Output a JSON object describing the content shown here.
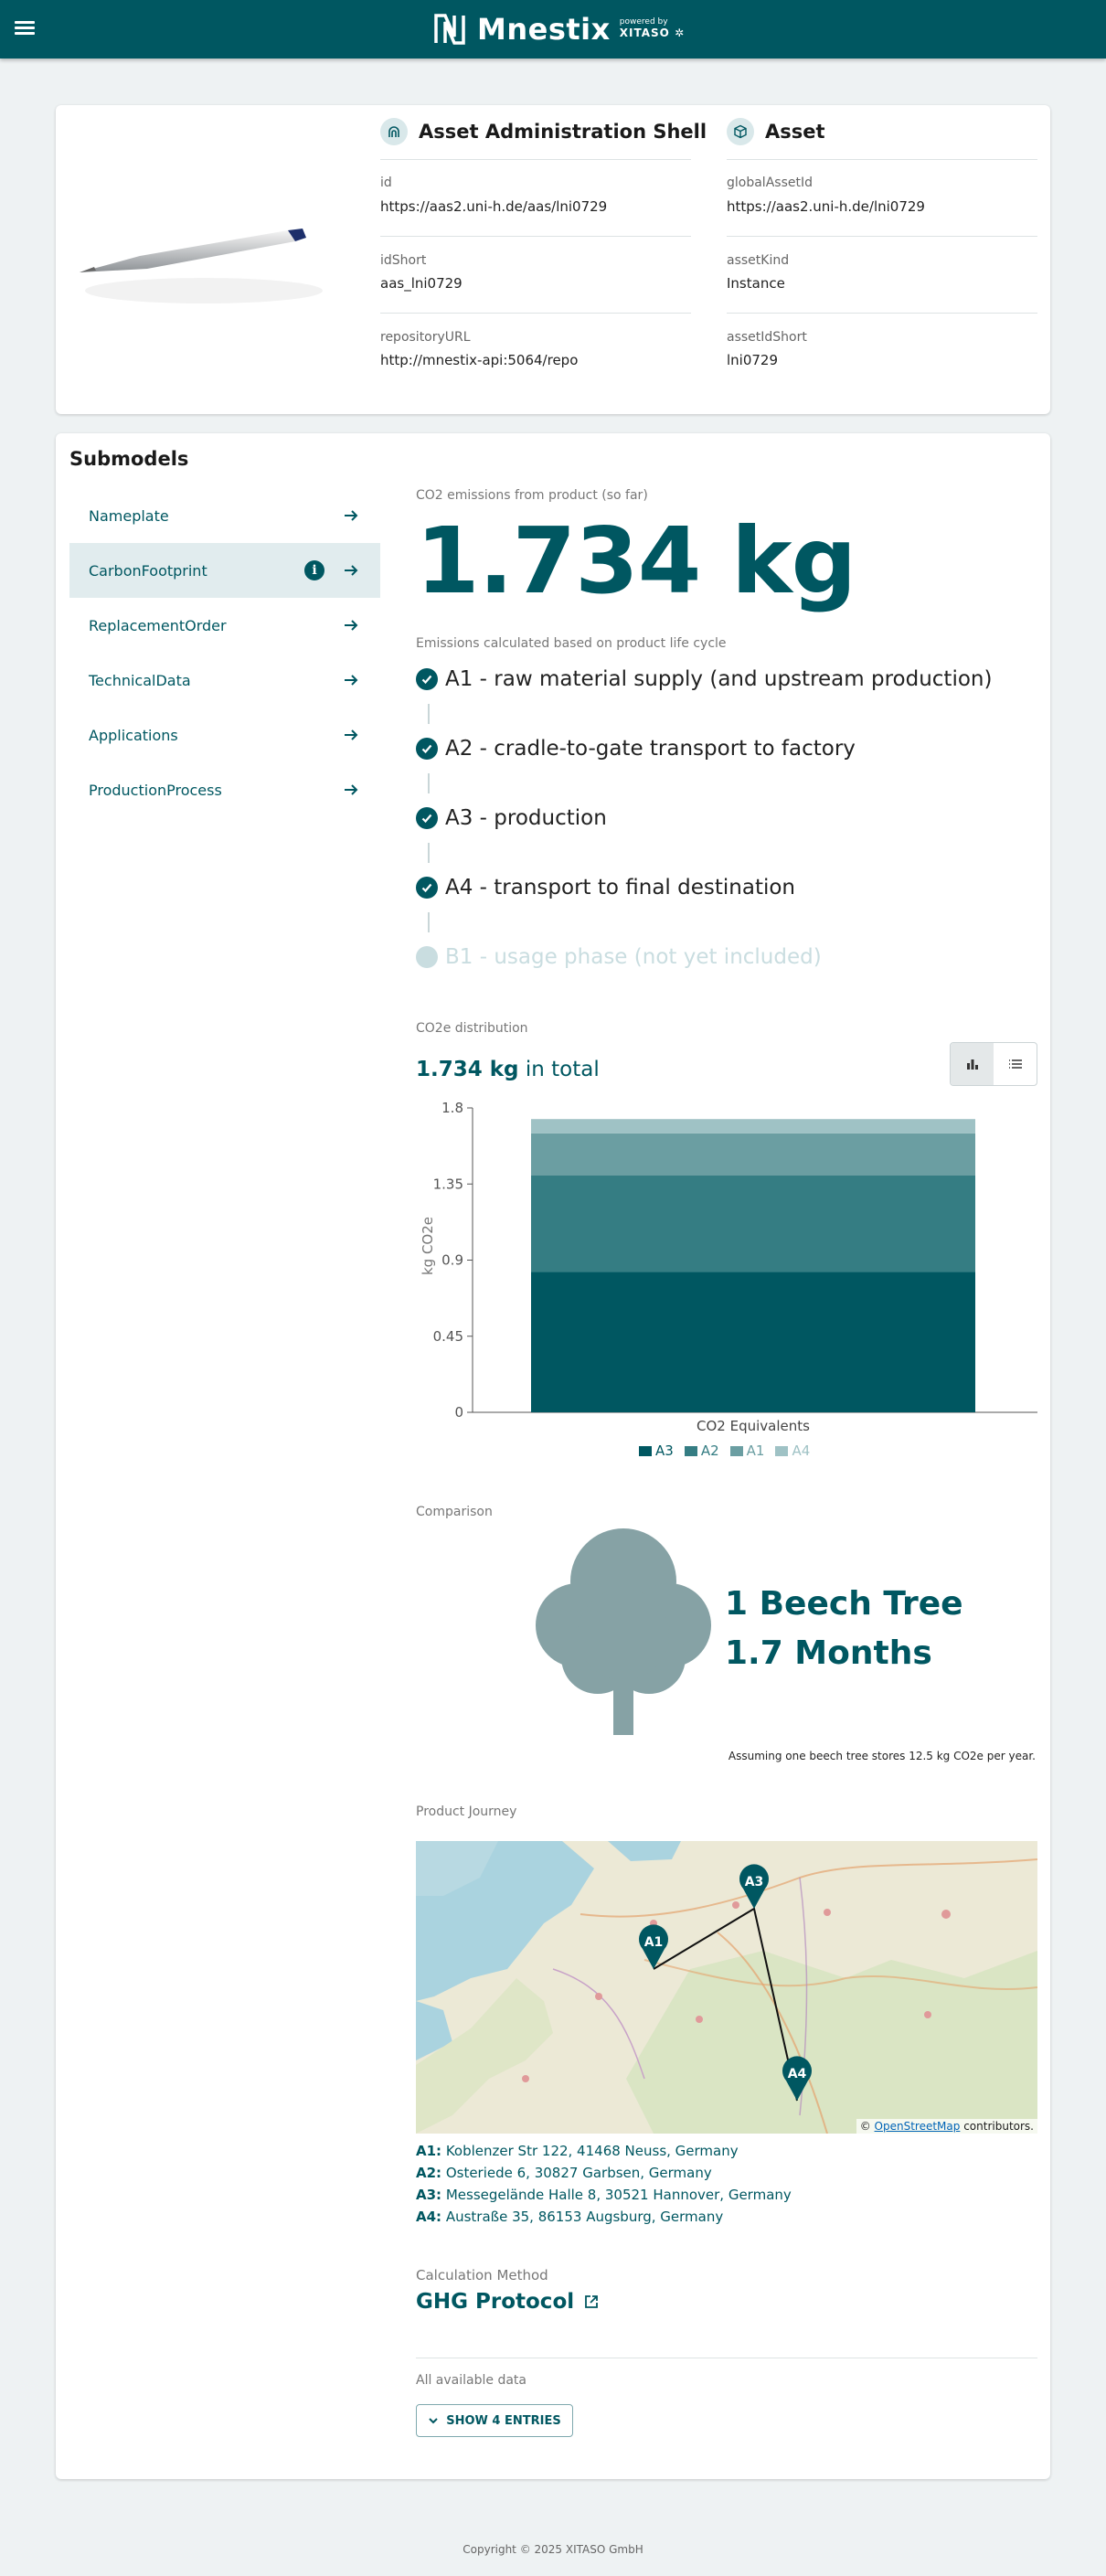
{
  "app": {
    "logo_text": "Mnestix",
    "powered_by": "powered by",
    "powered_company": "XITASO"
  },
  "aas": {
    "title": "Asset Administration Shell",
    "fields": [
      {
        "label": "id",
        "value": "https://aas2.uni-h.de/aas/lni0729"
      },
      {
        "label": "idShort",
        "value": "aas_lni0729"
      },
      {
        "label": "repositoryURL",
        "value": "http://mnestix-api:5064/repo"
      }
    ]
  },
  "asset": {
    "title": "Asset",
    "fields": [
      {
        "label": "globalAssetId",
        "value": "https://aas2.uni-h.de/lni0729"
      },
      {
        "label": "assetKind",
        "value": "Instance"
      },
      {
        "label": "assetIdShort",
        "value": "lni0729"
      }
    ]
  },
  "submodels": {
    "title": "Submodels",
    "items": [
      {
        "label": "Nameplate"
      },
      {
        "label": "CarbonFootprint"
      },
      {
        "label": "ReplacementOrder"
      },
      {
        "label": "TechnicalData"
      },
      {
        "label": "Applications"
      },
      {
        "label": "ProductionProcess"
      }
    ]
  },
  "carbon": {
    "emissions_label": "CO2 emissions from product (so far)",
    "emissions_value": "1.734 kg",
    "lifecycle_label": "Emissions calculated based on product life cycle",
    "stages": [
      {
        "label": "A1 - raw material supply (and upstream production)",
        "included": true
      },
      {
        "label": "A2 - cradle-to-gate transport to factory",
        "included": true
      },
      {
        "label": "A3 - production",
        "included": true
      },
      {
        "label": "A4 - transport to final destination",
        "included": true
      },
      {
        "label": "B1 - usage phase (not yet included)",
        "included": false
      }
    ],
    "distribution_label": "CO2e distribution",
    "total_value": "1.734 kg",
    "total_suffix": "in total",
    "comparison_label": "Comparison",
    "comparison_line1": "1 Beech Tree",
    "comparison_line2": "1.7 Months",
    "assumption": "Assuming one beech tree stores 12.5 kg CO2e per year.",
    "journey_label": "Product Journey",
    "map_attribution_link": "OpenStreetMap",
    "map_attribution_suffix": "contributors.",
    "addresses": [
      {
        "key": "A1:",
        "value": "Koblenzer Str 122, 41468 Neuss, Germany"
      },
      {
        "key": "A2:",
        "value": "Osteriede 6, 30827 Garbsen, Germany"
      },
      {
        "key": "A3:",
        "value": "Messegelände Halle 8, 30521 Hannover, Germany"
      },
      {
        "key": "A4:",
        "value": "Austraße 35, 86153 Augsburg, Germany"
      }
    ],
    "method_label": "Calculation Method",
    "method_value": "GHG Protocol",
    "all_data_label": "All available data",
    "show_button": "SHOW 4 ENTRIES",
    "map_markers": [
      "A1",
      "A3",
      "A4"
    ]
  },
  "chart_data": {
    "type": "bar",
    "stacked": true,
    "categories": [
      "CO2 Equivalents"
    ],
    "series": [
      {
        "name": "A3",
        "values": [
          0.83
        ],
        "color": "#005761"
      },
      {
        "name": "A2",
        "values": [
          0.57
        ],
        "color": "#357d83"
      },
      {
        "name": "A1",
        "values": [
          0.25
        ],
        "color": "#6b9ea2"
      },
      {
        "name": "A4",
        "values": [
          0.084
        ],
        "color": "#9fc2c5"
      }
    ],
    "ylabel": "kg CO2e",
    "xlabel": "CO2 Equivalents",
    "yticks": [
      "0",
      "0.45",
      "0.9",
      "1.35",
      "1.8"
    ],
    "ylim": [
      0,
      1.8
    ],
    "legend": "bottom"
  },
  "footer": {
    "text": "Copyright © 2025 XITASO GmbH"
  },
  "colors": {
    "primary": "#005761",
    "background": "#eef2f3"
  }
}
